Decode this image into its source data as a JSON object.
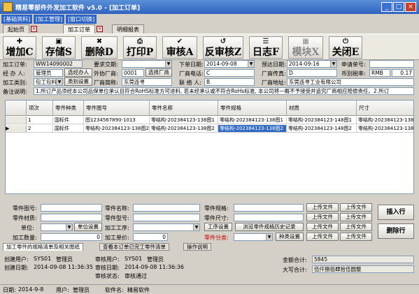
{
  "window": {
    "title": "精易零部件外发加工软件 v5.0 - [加工订单]",
    "min": "_",
    "max": "□",
    "close": "×"
  },
  "menu": [
    {
      "label": "[基础资料]"
    },
    {
      "label": "[加工管理]"
    },
    {
      "label": "[窗口切换]"
    }
  ],
  "tabs": [
    {
      "label": "起始页"
    },
    {
      "label": "加工订单"
    },
    {
      "label": "明细报表"
    }
  ],
  "toolbar": [
    {
      "label": "增加C",
      "icon": "add-icon",
      "glyph": "✚"
    },
    {
      "label": "存储S",
      "icon": "save-icon",
      "glyph": "▣"
    },
    {
      "label": "删除D",
      "icon": "delete-icon",
      "glyph": "✖"
    },
    {
      "label": "打印P",
      "icon": "print-icon",
      "glyph": "⎙"
    },
    {
      "label": "审核A",
      "icon": "audit-icon",
      "glyph": "✔"
    },
    {
      "label": "反审核Z",
      "icon": "unaudit-icon",
      "glyph": "↺"
    },
    {
      "label": "日志F",
      "icon": "log-icon",
      "glyph": "☰"
    },
    {
      "label": "模块X",
      "icon": "module-icon",
      "glyph": "▦"
    },
    {
      "label": "关闭E",
      "icon": "close-icon",
      "glyph": "⏻"
    }
  ],
  "form": {
    "order_no_label": "加工订单:",
    "order_no": "WW14090002",
    "req_date_label": "要求交期:",
    "req_date": "",
    "order_date_label": "下单日期:",
    "order_date": "2014-09-08",
    "delivery_label": "预达日期:",
    "delivery": "2014-09-16",
    "apply_no_label": "申请单号:",
    "apply_no": "",
    "handler_label": "经 办 人:",
    "handler": "管理员",
    "select_handler": "选经办人",
    "outsource_label": "外协厂商:",
    "outsource_code": "0001",
    "select_vendor": "选择厂商",
    "phone_label": "厂商电话:",
    "phone": "C",
    "fax_label": "厂商传真:",
    "fax": "D",
    "currency_label": "币别税率:",
    "currency": "RMB",
    "tax": "0.17",
    "type_label": "加工类别:",
    "type": "包工包料",
    "type_setting": "类别设置",
    "vendor_name_label": "厂商简称:",
    "vendor_name": "东莞连寻",
    "contact_label": "联 络 人:",
    "contact": "B",
    "address_label": "厂商地址:",
    "address": "东莞连寻工业有限公司",
    "notes_label": "备注说明:",
    "notes": "1.所订产品须经本公司品保单位承认且符合RoHS标准方可进料, 若未经承认或不符合RoHs标准, 本公司将一概不予接受并追究厂商相应赔偿责任。2.所订"
  },
  "grid": {
    "headers": [
      "项次",
      "零件种类",
      "零件图号",
      "零件名称",
      "零件规格",
      "材质",
      "尺寸"
    ],
    "rows": [
      {
        "marker": "",
        "no": "1",
        "kind": "国标件",
        "drawing": "图1234567890-1013",
        "name": "零结构-2023841​23-138图1",
        "spec": "零结构-202384123-138图1",
        "material": "零结构-202384123-148图1",
        "size": "零结构-202384123-138图1"
      },
      {
        "marker": "▶",
        "no": "2",
        "kind": "国标件",
        "drawing": "零结构-202384123-138图2",
        "name": "零结构-202384123-138图2",
        "spec": "零结构-202384123-138图2",
        "material": "零结构-202384123-148图2",
        "size": "零结构-202384123-138图2"
      }
    ]
  },
  "detail": {
    "part_no_label": "零件图号:",
    "part_mat_label": "零件材质:",
    "unit_label": "单位:",
    "unit_setting": "单位设置",
    "qty_label": "加工数量:",
    "qty": "0",
    "part_name_label": "零件名称:",
    "part_model_label": "零件型号:",
    "process_label": "加工工序:",
    "price_label": "加工单价:",
    "price": "0",
    "process_setting": "工序设置",
    "part_spec_label": "零件规格:",
    "part_size_label": "零件尺寸:",
    "part_kind_label": "零件分类:",
    "kind_setting": "种类设置",
    "history_btn": "浏览零件规格历史记录",
    "upload_label": "上传文件",
    "insert_row": "插入行",
    "delete_row": "删除行"
  },
  "bottom_tabs": [
    {
      "label": "加工零件的规格清单及相关图纸"
    },
    {
      "label": "查看本订单已完工零件清单"
    },
    {
      "label": "操作说明"
    }
  ],
  "footer": {
    "creator_label": "创建用户:",
    "creator_id": "SYS01",
    "creator_name": "管理员",
    "create_date_label": "创建日期:",
    "create_date": "2014-09-08 11:36:35",
    "reviewer_label": "审核用户:",
    "reviewer_id": "SYS01",
    "reviewer_name": "管理员",
    "review_date_label": "审核日期:",
    "review_date": "2014-09-08 11:36:36",
    "review_status_label": "审核状态:",
    "review_status": "审核通过",
    "amount_label": "金额合计:",
    "amount": "5845",
    "caps_label": "大写合计:",
    "caps": "伍仟捌佰肆拾伍圆整"
  },
  "status": {
    "date_label": "日期:",
    "date": "2014-9-8",
    "user_label": "用户:",
    "user": "管理员",
    "software_label": "软件名:",
    "software": "精易软件"
  },
  "colors": {
    "title_blue": "#2f63c0",
    "select_blue": "#316ac5"
  }
}
